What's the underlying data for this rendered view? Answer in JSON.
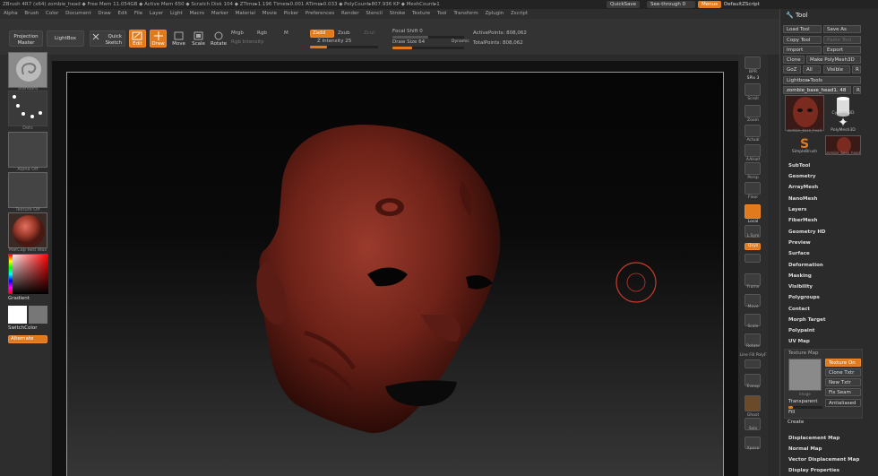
{
  "titlebar": {
    "text": "ZBrush 4R7 (x64)    zombie_head    ◆ Free Mem 11.054GB ◆ Active Mem 650 ◆ Scratch Disk 104 ◆  ZTime▸1.196 Timer▸0.001 ATime▸0.033 ◆ PolyCount▸807.936 KP  ◆ MeshCount▸1",
    "quicksave": "QuickSave",
    "seethrough": "See-through  0",
    "menus": "Menus",
    "script": "DefaultZScript"
  },
  "menubar": {
    "items": [
      "Alpha",
      "Brush",
      "Color",
      "Document",
      "Draw",
      "Edit",
      "File",
      "Layer",
      "Light",
      "Macro",
      "Marker",
      "Material",
      "Movie",
      "Picker",
      "Preferences",
      "Render",
      "Stencil",
      "Stroke",
      "Texture",
      "Tool",
      "Transform",
      "Zplugin",
      "Zscript"
    ]
  },
  "topshelf": {
    "projection_master": "Projection Master",
    "lightbox": "LightBox",
    "quick_sketch": "Quick Sketch",
    "edit": "Edit",
    "draw": "Draw",
    "move": "Move",
    "scale": "Scale",
    "rotate": "Rotate",
    "mrgb": "Mrgb",
    "rgb": "Rgb",
    "m": "M",
    "rgb_intensity": "Rgb Intensity",
    "zadd": "Zadd",
    "zsub": "Zsub",
    "zcut": "Zcut",
    "z_intensity": "Z Intensity 25",
    "focal_shift": "Focal Shift 0",
    "draw_size": "Draw Size 64",
    "dynamic": "Dynamic",
    "active_points": "ActivePoints: 808,062",
    "total_points": "TotalPoints: 808,062"
  },
  "leftshelf": {
    "standard": "Standard",
    "dots": "Dots",
    "alpha_off": "Alpha Off",
    "texture_off": "Texture Off",
    "matcap": "MatCap Red Wax",
    "gradient": "Gradient",
    "switchcolor": "SwitchColor",
    "alternate": "Alternate"
  },
  "rightshelf": {
    "items": [
      "BPR",
      "SPix 3",
      "Scroll",
      "Zoom",
      "Actual",
      "AAHalf",
      "Persp",
      "Floor",
      "Local",
      "L.Sym",
      "Qxyz",
      "",
      "Frame",
      "Move",
      "Scale",
      "Rotate",
      "Line Fill PolyF",
      "Transp",
      "Ghost",
      "Solo",
      "Xpose"
    ]
  },
  "palette": {
    "title": "Tool",
    "load_tool": "Load Tool",
    "save_as": "Save As",
    "copy_tool": "Copy Tool",
    "paste_tool": "Paste Tool",
    "import": "Import",
    "export": "Export",
    "clone": "Clone",
    "make_polymesh": "Make PolyMesh3D",
    "goz": "GoZ",
    "all": "All",
    "visible": "Visible",
    "r": "R",
    "lightbox_tools": "Lightbox▸Tools",
    "current_tool": "zombie_base_head1. 48",
    "thumbs": [
      "zombie_base_head",
      "Cylinder3D",
      "PolyMesh3D",
      "SimpleBrush",
      "zombie_base_head"
    ],
    "sections": [
      "SubTool",
      "Geometry",
      "ArrayMesh",
      "NanoMesh",
      "Layers",
      "FiberMesh",
      "Geometry HD",
      "Preview",
      "Surface",
      "Deformation",
      "Masking",
      "Visibility",
      "Polygroups",
      "Contact",
      "Morph Target",
      "Polypaint",
      "UV Map"
    ],
    "texture_map": "Texture Map",
    "texture_on": "Texture On",
    "clone_txtr": "Clone Txtr",
    "new_txtr": "New Txtr",
    "fix_seam": "Fix Seam",
    "image": "Image",
    "transparent": "Transparent",
    "antialiased": "Antialiased",
    "fill": "Fill",
    "create": "Create",
    "sections2": [
      "Displacement Map",
      "Normal Map",
      "Vector Displacement Map",
      "Display Properties"
    ]
  }
}
